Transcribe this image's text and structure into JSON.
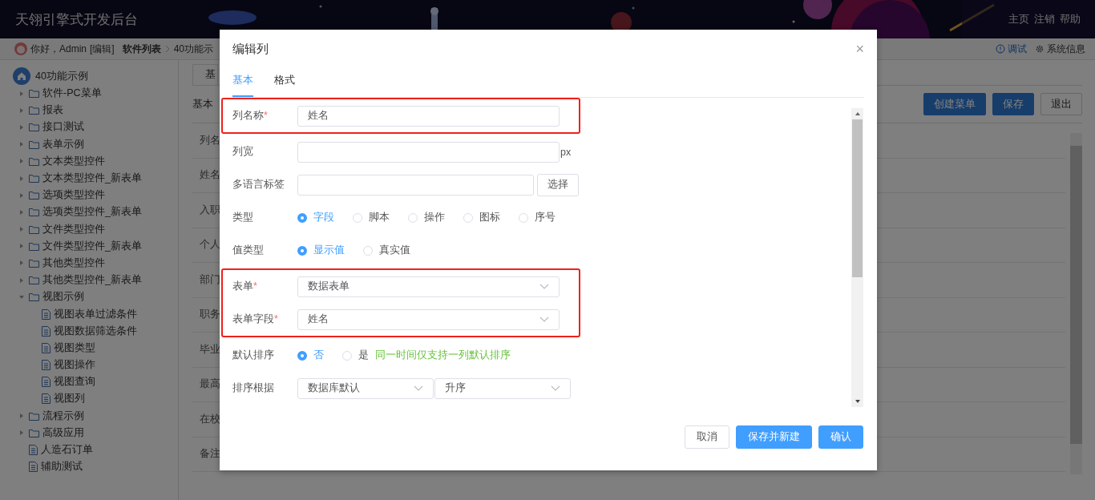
{
  "header": {
    "title": "天翎引擎式开发后台",
    "links": [
      "主页",
      "注销",
      "帮助"
    ]
  },
  "breadcrumb": {
    "greeting": "你好，Admin",
    "edit_link": "[编辑]",
    "current": "软件列表",
    "next": "40功能示",
    "tools": [
      {
        "label": "调试",
        "kind": "debug"
      },
      {
        "label": "系统信息",
        "kind": "info"
      }
    ]
  },
  "sidebar": {
    "root": "40功能示例",
    "items": [
      {
        "label": "软件-PC菜单",
        "kind": "folder",
        "expanded": false
      },
      {
        "label": "报表",
        "kind": "folder",
        "expanded": false
      },
      {
        "label": "接口测试",
        "kind": "folder",
        "expanded": false
      },
      {
        "label": "表单示例",
        "kind": "folder",
        "expanded": false
      },
      {
        "label": "文本类型控件",
        "kind": "folder",
        "expanded": false
      },
      {
        "label": "文本类型控件_新表单",
        "kind": "folder",
        "expanded": false
      },
      {
        "label": "选项类型控件",
        "kind": "folder",
        "expanded": false
      },
      {
        "label": "选项类型控件_新表单",
        "kind": "folder",
        "expanded": false
      },
      {
        "label": "文件类型控件",
        "kind": "folder",
        "expanded": false
      },
      {
        "label": "文件类型控件_新表单",
        "kind": "folder",
        "expanded": false
      },
      {
        "label": "其他类型控件",
        "kind": "folder",
        "expanded": false
      },
      {
        "label": "其他类型控件_新表单",
        "kind": "folder",
        "expanded": false
      },
      {
        "label": "视图示例",
        "kind": "folder",
        "expanded": true,
        "children": [
          {
            "label": "视图表单过滤条件",
            "kind": "page"
          },
          {
            "label": "视图数据筛选条件",
            "kind": "page"
          },
          {
            "label": "视图类型",
            "kind": "page"
          },
          {
            "label": "视图操作",
            "kind": "page"
          },
          {
            "label": "视图查询",
            "kind": "page"
          },
          {
            "label": "视图列",
            "kind": "page"
          }
        ]
      },
      {
        "label": "流程示例",
        "kind": "folder",
        "expanded": false
      },
      {
        "label": "高级应用",
        "kind": "folder",
        "expanded": false
      },
      {
        "label": "人造石订单",
        "kind": "page"
      },
      {
        "label": "辅助测试",
        "kind": "page"
      }
    ]
  },
  "main": {
    "tab": "基",
    "section": "基本",
    "buttons": [
      {
        "label": "创建菜单",
        "kind": "primary"
      },
      {
        "label": "保存",
        "kind": "primary"
      },
      {
        "label": "退出",
        "kind": "default"
      }
    ],
    "rows": [
      "列名",
      "姓名",
      "入职",
      "个人",
      "部门",
      "职务",
      "毕业",
      "最高",
      "在校",
      "备注"
    ]
  },
  "dialog": {
    "title": "编辑列",
    "close": "×",
    "tabs": [
      {
        "label": "基本",
        "selected": true
      },
      {
        "label": "格式",
        "selected": false
      }
    ],
    "groups": [
      {
        "highlighted": true,
        "rows": [
          {
            "kind": "text",
            "label": "列名称",
            "mark": "*",
            "value": "姓名"
          }
        ]
      },
      {
        "highlighted": false,
        "rows": [
          {
            "kind": "text",
            "label": "列宽",
            "suffix": "px"
          },
          {
            "kind": "text",
            "label": "多语言标签",
            "button": "选择"
          },
          {
            "kind": "radio",
            "label": "类型",
            "options": [
              {
                "label": "字段",
                "selected": true
              },
              {
                "label": "脚本",
                "selected": false
              },
              {
                "label": "操作",
                "selected": false
              },
              {
                "label": "图标",
                "selected": false
              },
              {
                "label": "序号",
                "selected": false
              }
            ]
          },
          {
            "kind": "radio",
            "label": "值类型",
            "options": [
              {
                "label": "显示值",
                "selected": true
              },
              {
                "label": "真实值",
                "selected": false
              }
            ]
          }
        ]
      },
      {
        "highlighted": true,
        "rows": [
          {
            "kind": "select",
            "label": "表单",
            "mark": "*",
            "values": [
              "数据表单"
            ]
          },
          {
            "kind": "select",
            "label": "表单字段",
            "mark": "*",
            "values": [
              "姓名"
            ]
          }
        ]
      },
      {
        "highlighted": false,
        "rows": [
          {
            "kind": "radio",
            "label": "默认排序",
            "options": [
              {
                "label": "否",
                "selected": true
              },
              {
                "label": "是",
                "selected": false
              }
            ],
            "note": "同一时间仅支持一列默认排序"
          },
          {
            "kind": "select",
            "label": "排序根据",
            "values": [
              "数据库默认",
              "升序"
            ]
          }
        ]
      }
    ],
    "buttons": [
      {
        "label": "取消",
        "kind": "default"
      },
      {
        "label": "保存并新建",
        "kind": "primary"
      },
      {
        "label": "确认",
        "kind": "primary"
      }
    ]
  }
}
